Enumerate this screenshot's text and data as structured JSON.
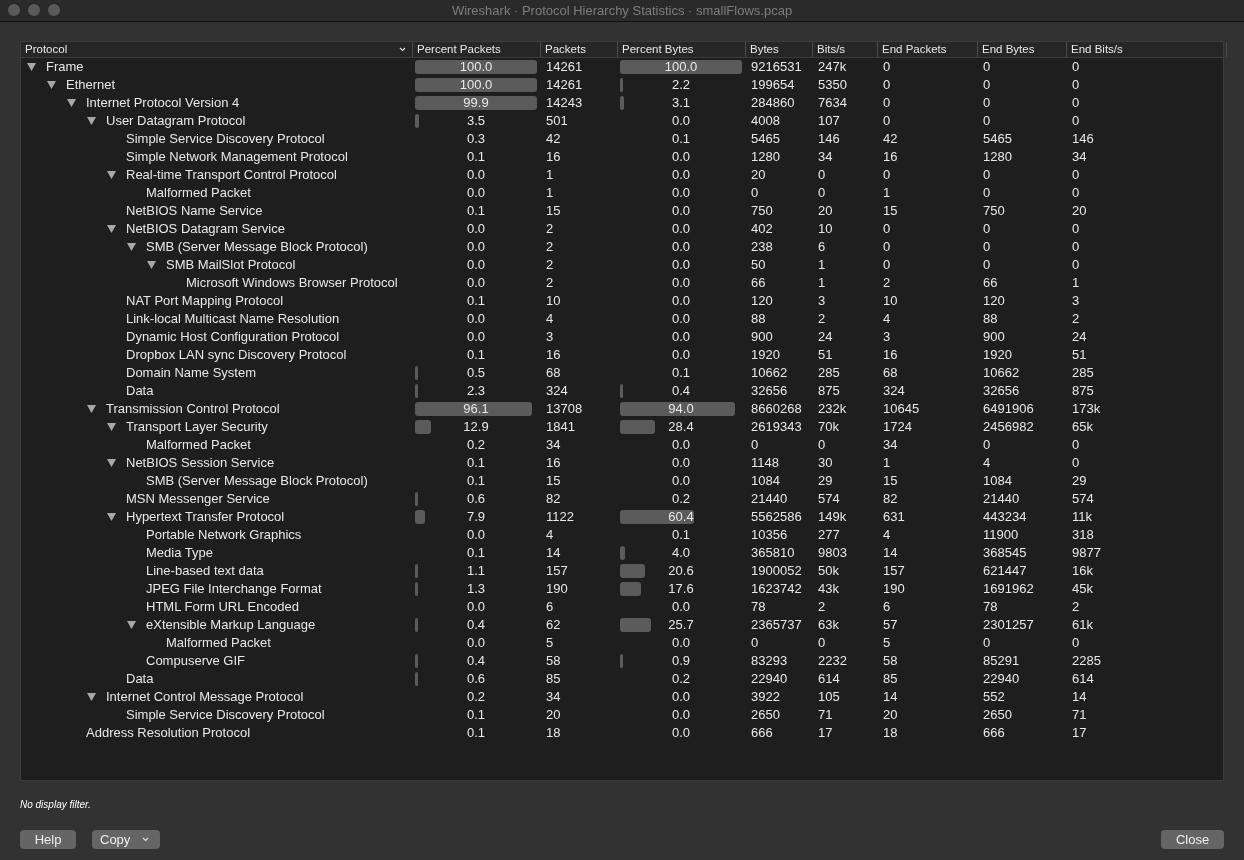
{
  "window": {
    "title": "Wireshark · Protocol Hierarchy Statistics · smallFlows.pcap"
  },
  "table": {
    "columns": [
      "Protocol",
      "Percent Packets",
      "Packets",
      "Percent Bytes",
      "Bytes",
      "Bits/s",
      "End Packets",
      "End Bytes",
      "End Bits/s"
    ],
    "rows": [
      {
        "name": "Frame",
        "expanded": true,
        "pct_packets": "100.0",
        "packets": "14261",
        "pct_bytes": "100.0",
        "bytes": "9216531",
        "bits": "247k",
        "end_packets": "0",
        "end_bytes": "0",
        "end_bits": "0",
        "children": [
          {
            "name": "Ethernet",
            "expanded": true,
            "pct_packets": "100.0",
            "packets": "14261",
            "pct_bytes": "2.2",
            "bytes": "199654",
            "bits": "5350",
            "end_packets": "0",
            "end_bytes": "0",
            "end_bits": "0",
            "children": [
              {
                "name": "Internet Protocol Version 4",
                "expanded": true,
                "pct_packets": "99.9",
                "packets": "14243",
                "pct_bytes": "3.1",
                "bytes": "284860",
                "bits": "7634",
                "end_packets": "0",
                "end_bytes": "0",
                "end_bits": "0",
                "children": [
                  {
                    "name": "User Datagram Protocol",
                    "expanded": true,
                    "pct_packets": "3.5",
                    "packets": "501",
                    "pct_bytes": "0.0",
                    "bytes": "4008",
                    "bits": "107",
                    "end_packets": "0",
                    "end_bytes": "0",
                    "end_bits": "0",
                    "children": [
                      {
                        "name": "Simple Service Discovery Protocol",
                        "pct_packets": "0.3",
                        "packets": "42",
                        "pct_bytes": "0.1",
                        "bytes": "5465",
                        "bits": "146",
                        "end_packets": "42",
                        "end_bytes": "5465",
                        "end_bits": "146"
                      },
                      {
                        "name": "Simple Network Management Protocol",
                        "pct_packets": "0.1",
                        "packets": "16",
                        "pct_bytes": "0.0",
                        "bytes": "1280",
                        "bits": "34",
                        "end_packets": "16",
                        "end_bytes": "1280",
                        "end_bits": "34"
                      },
                      {
                        "name": "Real-time Transport Control Protocol",
                        "expanded": true,
                        "pct_packets": "0.0",
                        "packets": "1",
                        "pct_bytes": "0.0",
                        "bytes": "20",
                        "bits": "0",
                        "end_packets": "0",
                        "end_bytes": "0",
                        "end_bits": "0",
                        "children": [
                          {
                            "name": "Malformed Packet",
                            "pct_packets": "0.0",
                            "packets": "1",
                            "pct_bytes": "0.0",
                            "bytes": "0",
                            "bits": "0",
                            "end_packets": "1",
                            "end_bytes": "0",
                            "end_bits": "0"
                          }
                        ]
                      },
                      {
                        "name": "NetBIOS Name Service",
                        "pct_packets": "0.1",
                        "packets": "15",
                        "pct_bytes": "0.0",
                        "bytes": "750",
                        "bits": "20",
                        "end_packets": "15",
                        "end_bytes": "750",
                        "end_bits": "20"
                      },
                      {
                        "name": "NetBIOS Datagram Service",
                        "expanded": true,
                        "pct_packets": "0.0",
                        "packets": "2",
                        "pct_bytes": "0.0",
                        "bytes": "402",
                        "bits": "10",
                        "end_packets": "0",
                        "end_bytes": "0",
                        "end_bits": "0",
                        "children": [
                          {
                            "name": "SMB (Server Message Block Protocol)",
                            "expanded": true,
                            "pct_packets": "0.0",
                            "packets": "2",
                            "pct_bytes": "0.0",
                            "bytes": "238",
                            "bits": "6",
                            "end_packets": "0",
                            "end_bytes": "0",
                            "end_bits": "0",
                            "children": [
                              {
                                "name": "SMB MailSlot Protocol",
                                "expanded": true,
                                "pct_packets": "0.0",
                                "packets": "2",
                                "pct_bytes": "0.0",
                                "bytes": "50",
                                "bits": "1",
                                "end_packets": "0",
                                "end_bytes": "0",
                                "end_bits": "0",
                                "children": [
                                  {
                                    "name": "Microsoft Windows Browser Protocol",
                                    "pct_packets": "0.0",
                                    "packets": "2",
                                    "pct_bytes": "0.0",
                                    "bytes": "66",
                                    "bits": "1",
                                    "end_packets": "2",
                                    "end_bytes": "66",
                                    "end_bits": "1"
                                  }
                                ]
                              }
                            ]
                          }
                        ]
                      },
                      {
                        "name": "NAT Port Mapping Protocol",
                        "pct_packets": "0.1",
                        "packets": "10",
                        "pct_bytes": "0.0",
                        "bytes": "120",
                        "bits": "3",
                        "end_packets": "10",
                        "end_bytes": "120",
                        "end_bits": "3"
                      },
                      {
                        "name": "Link-local Multicast Name Resolution",
                        "pct_packets": "0.0",
                        "packets": "4",
                        "pct_bytes": "0.0",
                        "bytes": "88",
                        "bits": "2",
                        "end_packets": "4",
                        "end_bytes": "88",
                        "end_bits": "2"
                      },
                      {
                        "name": "Dynamic Host Configuration Protocol",
                        "pct_packets": "0.0",
                        "packets": "3",
                        "pct_bytes": "0.0",
                        "bytes": "900",
                        "bits": "24",
                        "end_packets": "3",
                        "end_bytes": "900",
                        "end_bits": "24"
                      },
                      {
                        "name": "Dropbox LAN sync Discovery Protocol",
                        "pct_packets": "0.1",
                        "packets": "16",
                        "pct_bytes": "0.0",
                        "bytes": "1920",
                        "bits": "51",
                        "end_packets": "16",
                        "end_bytes": "1920",
                        "end_bits": "51"
                      },
                      {
                        "name": "Domain Name System",
                        "pct_packets": "0.5",
                        "packets": "68",
                        "pct_bytes": "0.1",
                        "bytes": "10662",
                        "bits": "285",
                        "end_packets": "68",
                        "end_bytes": "10662",
                        "end_bits": "285"
                      },
                      {
                        "name": "Data",
                        "pct_packets": "2.3",
                        "packets": "324",
                        "pct_bytes": "0.4",
                        "bytes": "32656",
                        "bits": "875",
                        "end_packets": "324",
                        "end_bytes": "32656",
                        "end_bits": "875"
                      }
                    ]
                  },
                  {
                    "name": "Transmission Control Protocol",
                    "expanded": true,
                    "pct_packets": "96.1",
                    "packets": "13708",
                    "pct_bytes": "94.0",
                    "bytes": "8660268",
                    "bits": "232k",
                    "end_packets": "10645",
                    "end_bytes": "6491906",
                    "end_bits": "173k",
                    "children": [
                      {
                        "name": "Transport Layer Security",
                        "expanded": true,
                        "pct_packets": "12.9",
                        "packets": "1841",
                        "pct_bytes": "28.4",
                        "bytes": "2619343",
                        "bits": "70k",
                        "end_packets": "1724",
                        "end_bytes": "2456982",
                        "end_bits": "65k",
                        "children": [
                          {
                            "name": "Malformed Packet",
                            "pct_packets": "0.2",
                            "packets": "34",
                            "pct_bytes": "0.0",
                            "bytes": "0",
                            "bits": "0",
                            "end_packets": "34",
                            "end_bytes": "0",
                            "end_bits": "0"
                          }
                        ]
                      },
                      {
                        "name": "NetBIOS Session Service",
                        "expanded": true,
                        "pct_packets": "0.1",
                        "packets": "16",
                        "pct_bytes": "0.0",
                        "bytes": "1148",
                        "bits": "30",
                        "end_packets": "1",
                        "end_bytes": "4",
                        "end_bits": "0",
                        "children": [
                          {
                            "name": "SMB (Server Message Block Protocol)",
                            "pct_packets": "0.1",
                            "packets": "15",
                            "pct_bytes": "0.0",
                            "bytes": "1084",
                            "bits": "29",
                            "end_packets": "15",
                            "end_bytes": "1084",
                            "end_bits": "29"
                          }
                        ]
                      },
                      {
                        "name": "MSN Messenger Service",
                        "pct_packets": "0.6",
                        "packets": "82",
                        "pct_bytes": "0.2",
                        "bytes": "21440",
                        "bits": "574",
                        "end_packets": "82",
                        "end_bytes": "21440",
                        "end_bits": "574"
                      },
                      {
                        "name": "Hypertext Transfer Protocol",
                        "expanded": true,
                        "pct_packets": "7.9",
                        "packets": "1122",
                        "pct_bytes": "60.4",
                        "bytes": "5562586",
                        "bits": "149k",
                        "end_packets": "631",
                        "end_bytes": "443234",
                        "end_bits": "11k",
                        "children": [
                          {
                            "name": "Portable Network Graphics",
                            "pct_packets": "0.0",
                            "packets": "4",
                            "pct_bytes": "0.1",
                            "bytes": "10356",
                            "bits": "277",
                            "end_packets": "4",
                            "end_bytes": "11900",
                            "end_bits": "318"
                          },
                          {
                            "name": "Media Type",
                            "pct_packets": "0.1",
                            "packets": "14",
                            "pct_bytes": "4.0",
                            "bytes": "365810",
                            "bits": "9803",
                            "end_packets": "14",
                            "end_bytes": "368545",
                            "end_bits": "9877"
                          },
                          {
                            "name": "Line-based text data",
                            "pct_packets": "1.1",
                            "packets": "157",
                            "pct_bytes": "20.6",
                            "bytes": "1900052",
                            "bits": "50k",
                            "end_packets": "157",
                            "end_bytes": "621447",
                            "end_bits": "16k"
                          },
                          {
                            "name": "JPEG File Interchange Format",
                            "pct_packets": "1.3",
                            "packets": "190",
                            "pct_bytes": "17.6",
                            "bytes": "1623742",
                            "bits": "43k",
                            "end_packets": "190",
                            "end_bytes": "1691962",
                            "end_bits": "45k"
                          },
                          {
                            "name": "HTML Form URL Encoded",
                            "pct_packets": "0.0",
                            "packets": "6",
                            "pct_bytes": "0.0",
                            "bytes": "78",
                            "bits": "2",
                            "end_packets": "6",
                            "end_bytes": "78",
                            "end_bits": "2"
                          },
                          {
                            "name": "eXtensible Markup Language",
                            "expanded": true,
                            "pct_packets": "0.4",
                            "packets": "62",
                            "pct_bytes": "25.7",
                            "bytes": "2365737",
                            "bits": "63k",
                            "end_packets": "57",
                            "end_bytes": "2301257",
                            "end_bits": "61k",
                            "children": [
                              {
                                "name": "Malformed Packet",
                                "pct_packets": "0.0",
                                "packets": "5",
                                "pct_bytes": "0.0",
                                "bytes": "0",
                                "bits": "0",
                                "end_packets": "5",
                                "end_bytes": "0",
                                "end_bits": "0"
                              }
                            ]
                          },
                          {
                            "name": "Compuserve GIF",
                            "pct_packets": "0.4",
                            "packets": "58",
                            "pct_bytes": "0.9",
                            "bytes": "83293",
                            "bits": "2232",
                            "end_packets": "58",
                            "end_bytes": "85291",
                            "end_bits": "2285"
                          }
                        ]
                      },
                      {
                        "name": "Data",
                        "pct_packets": "0.6",
                        "packets": "85",
                        "pct_bytes": "0.2",
                        "bytes": "22940",
                        "bits": "614",
                        "end_packets": "85",
                        "end_bytes": "22940",
                        "end_bits": "614"
                      }
                    ]
                  },
                  {
                    "name": "Internet Control Message Protocol",
                    "expanded": true,
                    "pct_packets": "0.2",
                    "packets": "34",
                    "pct_bytes": "0.0",
                    "bytes": "3922",
                    "bits": "105",
                    "end_packets": "14",
                    "end_bytes": "552",
                    "end_bits": "14",
                    "children": [
                      {
                        "name": "Simple Service Discovery Protocol",
                        "pct_packets": "0.1",
                        "packets": "20",
                        "pct_bytes": "0.0",
                        "bytes": "2650",
                        "bits": "71",
                        "end_packets": "20",
                        "end_bytes": "2650",
                        "end_bits": "71"
                      }
                    ]
                  }
                ]
              },
              {
                "name": "Address Resolution Protocol",
                "pct_packets": "0.1",
                "packets": "18",
                "pct_bytes": "0.0",
                "bytes": "666",
                "bits": "17",
                "end_packets": "18",
                "end_bytes": "666",
                "end_bits": "17"
              }
            ]
          }
        ]
      }
    ]
  },
  "status": "No display filter.",
  "buttons": {
    "help": "Help",
    "copy": "Copy",
    "close": "Close"
  }
}
